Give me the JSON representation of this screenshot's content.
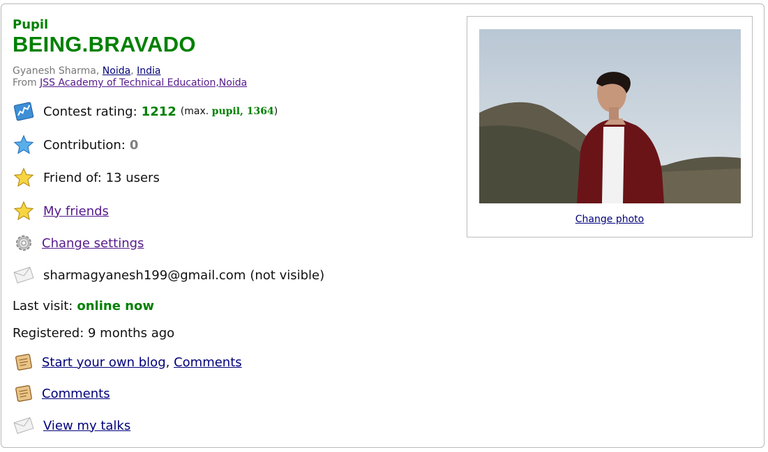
{
  "profile": {
    "rank": "Pupil",
    "handle": "BEING.BRAVADO",
    "real_name": "Gyanesh Sharma",
    "city": "Noida",
    "country": "India",
    "from_label": "From",
    "organization": "JSS Academy of Technical Education,Noida",
    "colors": {
      "pupil_green": "#008000",
      "link_blue": "#00007a",
      "visited_purple": "#551a8b",
      "gray": "#808080"
    }
  },
  "stats": {
    "rating_label": "Contest rating:",
    "rating_value": "1212",
    "max_open": "(max.",
    "max_rank": "pupil, 1364",
    "max_close": ")",
    "contribution_label": "Contribution:",
    "contribution_value": "0",
    "friend_of": "Friend of: 13 users"
  },
  "links": {
    "my_friends": "My friends",
    "change_settings": "Change settings",
    "start_blog": "Start your own blog",
    "comments_inline": "Comments",
    "comments": "Comments",
    "view_talks": "View my talks",
    "change_photo": "Change photo"
  },
  "info": {
    "email": "sharmagyanesh199@gmail.com",
    "email_visibility": "(not visible)",
    "last_visit_label": "Last visit:",
    "last_visit_value": "online now",
    "registered": "Registered: 9 months ago"
  },
  "icons": {
    "rating": "rating-chart-icon",
    "contribution": "blue-star-icon",
    "friend_of": "gold-star-icon",
    "my_friends": "gold-star-icon",
    "settings": "gear-icon",
    "email": "envelope-icon",
    "blog": "blog-notepad-icon",
    "comments": "comments-notepad-icon",
    "talks": "envelope-icon"
  }
}
